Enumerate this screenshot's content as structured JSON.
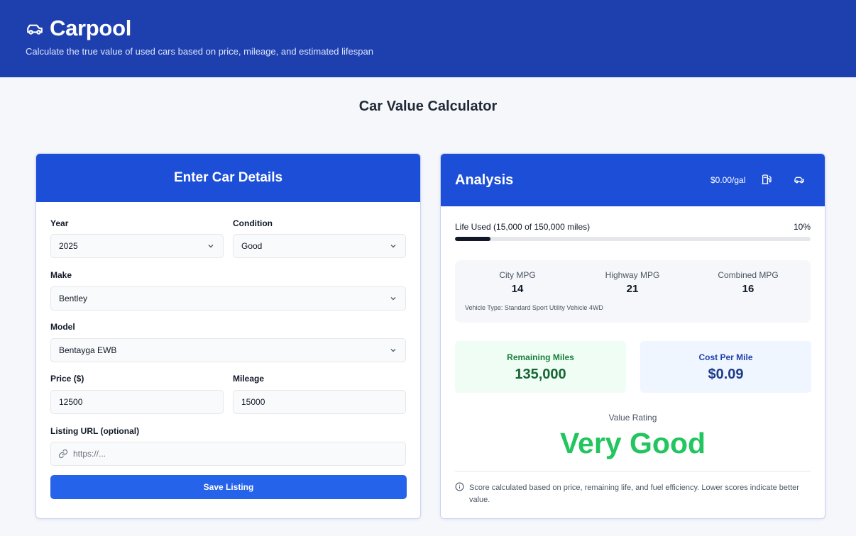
{
  "header": {
    "brand_icon": "car-icon",
    "title": "Carpool",
    "tagline": "Calculate the true value of used cars based on price, mileage, and estimated lifespan",
    "background": "#1e40af"
  },
  "page": {
    "title": "Car Value Calculator"
  },
  "form": {
    "heading": "Enter Car Details",
    "year": {
      "label": "Year",
      "value": "2025"
    },
    "condition": {
      "label": "Condition",
      "value": "Good"
    },
    "make": {
      "label": "Make",
      "value": "Bentley"
    },
    "model": {
      "label": "Model",
      "value": "Bentayga EWB"
    },
    "price": {
      "label": "Price ($)",
      "value": "12500"
    },
    "mileage": {
      "label": "Mileage",
      "value": "15000"
    },
    "url": {
      "label": "Listing URL (optional)",
      "placeholder": "https://...",
      "icon": "link-icon"
    },
    "save_label": "Save Listing"
  },
  "analysis": {
    "heading": "Analysis",
    "gas_price": "$0.00/gal",
    "icons": [
      "fuel-pump-icon",
      "car-icon"
    ],
    "life": {
      "label": "Life Used (15,000 of 150,000 miles)",
      "percent_label": "10%",
      "fraction": 0.1
    },
    "mpg": {
      "city": {
        "label": "City MPG",
        "value": "14"
      },
      "highway": {
        "label": "Highway MPG",
        "value": "21"
      },
      "combined": {
        "label": "Combined MPG",
        "value": "16"
      },
      "vehicle_type": "Vehicle Type: Standard Sport Utility Vehicle 4WD"
    },
    "remaining": {
      "label": "Remaining Miles",
      "value": "135,000"
    },
    "cost": {
      "label": "Cost Per Mile",
      "value": "$0.09"
    },
    "rating": {
      "label": "Value Rating",
      "value": "Very Good",
      "color": "#22c55e"
    },
    "note": "Score calculated based on price, remaining life, and fuel efficiency. Lower scores indicate better value."
  }
}
